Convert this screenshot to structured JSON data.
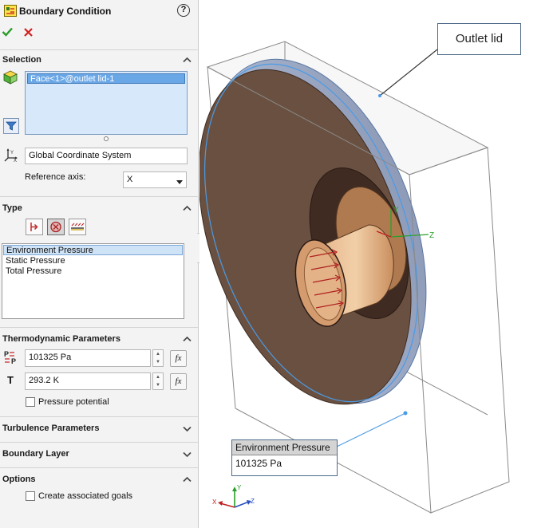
{
  "header": {
    "title": "Boundary Condition",
    "help": "?"
  },
  "selection": {
    "title": "Selection",
    "faces": [
      "Face<1>@outlet lid-1"
    ],
    "coordinate_system": "Global Coordinate System",
    "reference_axis_label": "Reference axis:",
    "reference_axis_value": "X"
  },
  "type": {
    "title": "Type",
    "items": [
      "Environment Pressure",
      "Static Pressure",
      "Total Pressure"
    ],
    "selected": "Environment Pressure"
  },
  "thermo": {
    "title": "Thermodynamic Parameters",
    "pressure_value": "101325 Pa",
    "temperature_label": "T",
    "temperature_value": "293.2 K",
    "fx_label": "fx",
    "pressure_potential_label": "Pressure potential"
  },
  "turbulence": {
    "title": "Turbulence Parameters"
  },
  "boundary_layer": {
    "title": "Boundary Layer"
  },
  "options": {
    "title": "Options",
    "create_goals_label": "Create associated goals"
  },
  "viewport": {
    "callout_label": "Outlet lid",
    "annotation_header": "Environment Pressure",
    "annotation_value": "101325 Pa",
    "axis_labels": {
      "x": "X",
      "y": "Y",
      "z": "Z"
    }
  },
  "colors": {
    "accent_blue": "#2f6fbf",
    "ok_green": "#2a9a2a",
    "cancel_red": "#d21f1f",
    "disc": "#6a5040",
    "cylinder": "#d9a57a"
  }
}
